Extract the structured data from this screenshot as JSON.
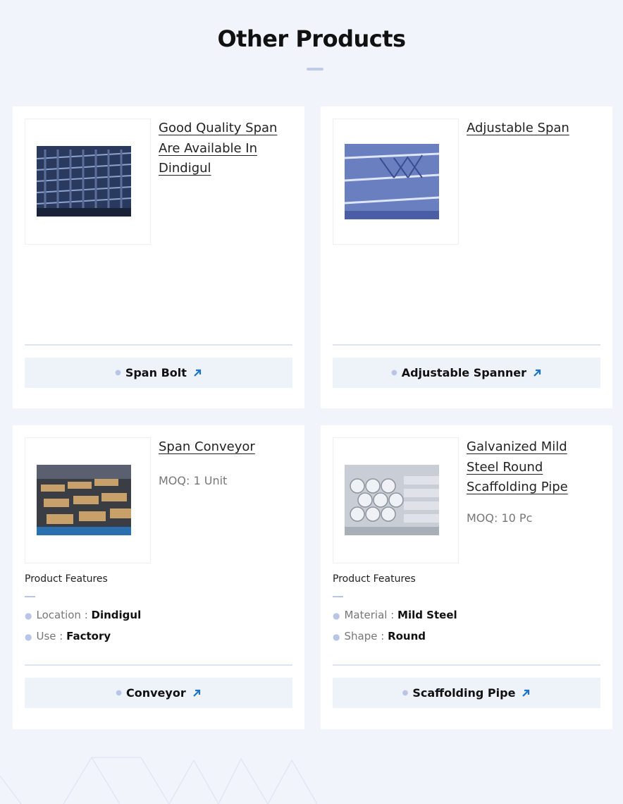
{
  "section": {
    "title": "Other Products"
  },
  "products": [
    {
      "title": "Good Quality Span Are Available In Dindigul",
      "category": "Span Bolt",
      "image_icon": "span-bolt-photo"
    },
    {
      "title": "Adjustable Span",
      "category": "Adjustable Spanner",
      "image_icon": "adjustable-span-photo"
    },
    {
      "title": "Span Conveyor",
      "moq": "MOQ: 1 Unit",
      "features_heading": "Product Features",
      "features": [
        {
          "label": "Location",
          "value": "Dindigul"
        },
        {
          "label": "Use",
          "value": "Factory"
        }
      ],
      "category": "Conveyor",
      "image_icon": "conveyor-photo"
    },
    {
      "title": "Galvanized Mild Steel Round Scaffolding Pipe",
      "moq": "MOQ: 10 Pc",
      "features_heading": "Product Features",
      "features": [
        {
          "label": "Material",
          "value": "Mild Steel"
        },
        {
          "label": "Shape",
          "value": "Round"
        }
      ],
      "category": "Scaffolding Pipe",
      "image_icon": "scaffolding-pipe-photo"
    }
  ],
  "colors": {
    "background": "#f1f5fb",
    "card": "#ffffff",
    "accent_arrow": "#1a73c9",
    "bar": "#c0cbe8"
  }
}
